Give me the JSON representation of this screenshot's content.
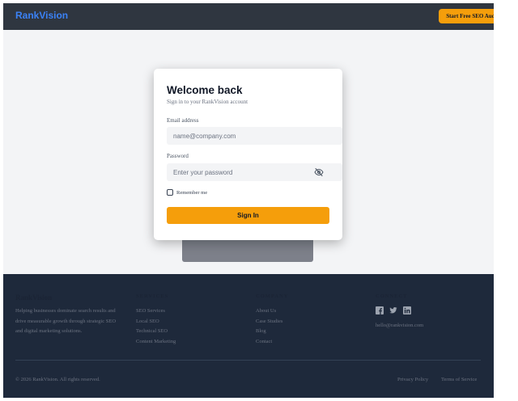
{
  "header": {
    "logo": "RankVision",
    "cta_label": "Start Free SEO Audit"
  },
  "login": {
    "title": "Welcome back",
    "subtitle": "Sign in to your RankVision account",
    "email_label": "Email address",
    "email_placeholder": "name@company.com",
    "password_label": "Password",
    "password_placeholder": "Enter your password",
    "remember_label": "Remember me",
    "signin_label": "Sign In"
  },
  "footer": {
    "brand": "RankVision",
    "description": "Helping businesses dominate search results and drive measurable growth through strategic SEO and digital marketing solutions.",
    "services_heading": "SERVICES",
    "services": [
      "SEO Services",
      "Local SEO",
      "Technical SEO",
      "Content Marketing"
    ],
    "company_heading": "COMPANY",
    "company": [
      "About Us",
      "Case Studies",
      "Blog",
      "Contact"
    ],
    "connect_heading": "CONNECT",
    "email": "hello@rankvision.com",
    "copyright": "© 2026 RankVision. All rights reserved.",
    "privacy": "Privacy Policy",
    "terms": "Terms of Service"
  },
  "icons": {
    "eye": "eye-off-icon",
    "social": [
      "facebook-icon",
      "twitter-icon",
      "linkedin-icon"
    ]
  },
  "colors": {
    "header_bg": "#2f3640",
    "brand_blue": "#3b82f6",
    "accent_orange": "#f59e0b",
    "footer_bg": "#1e293b",
    "page_bg": "#f3f4f6"
  }
}
